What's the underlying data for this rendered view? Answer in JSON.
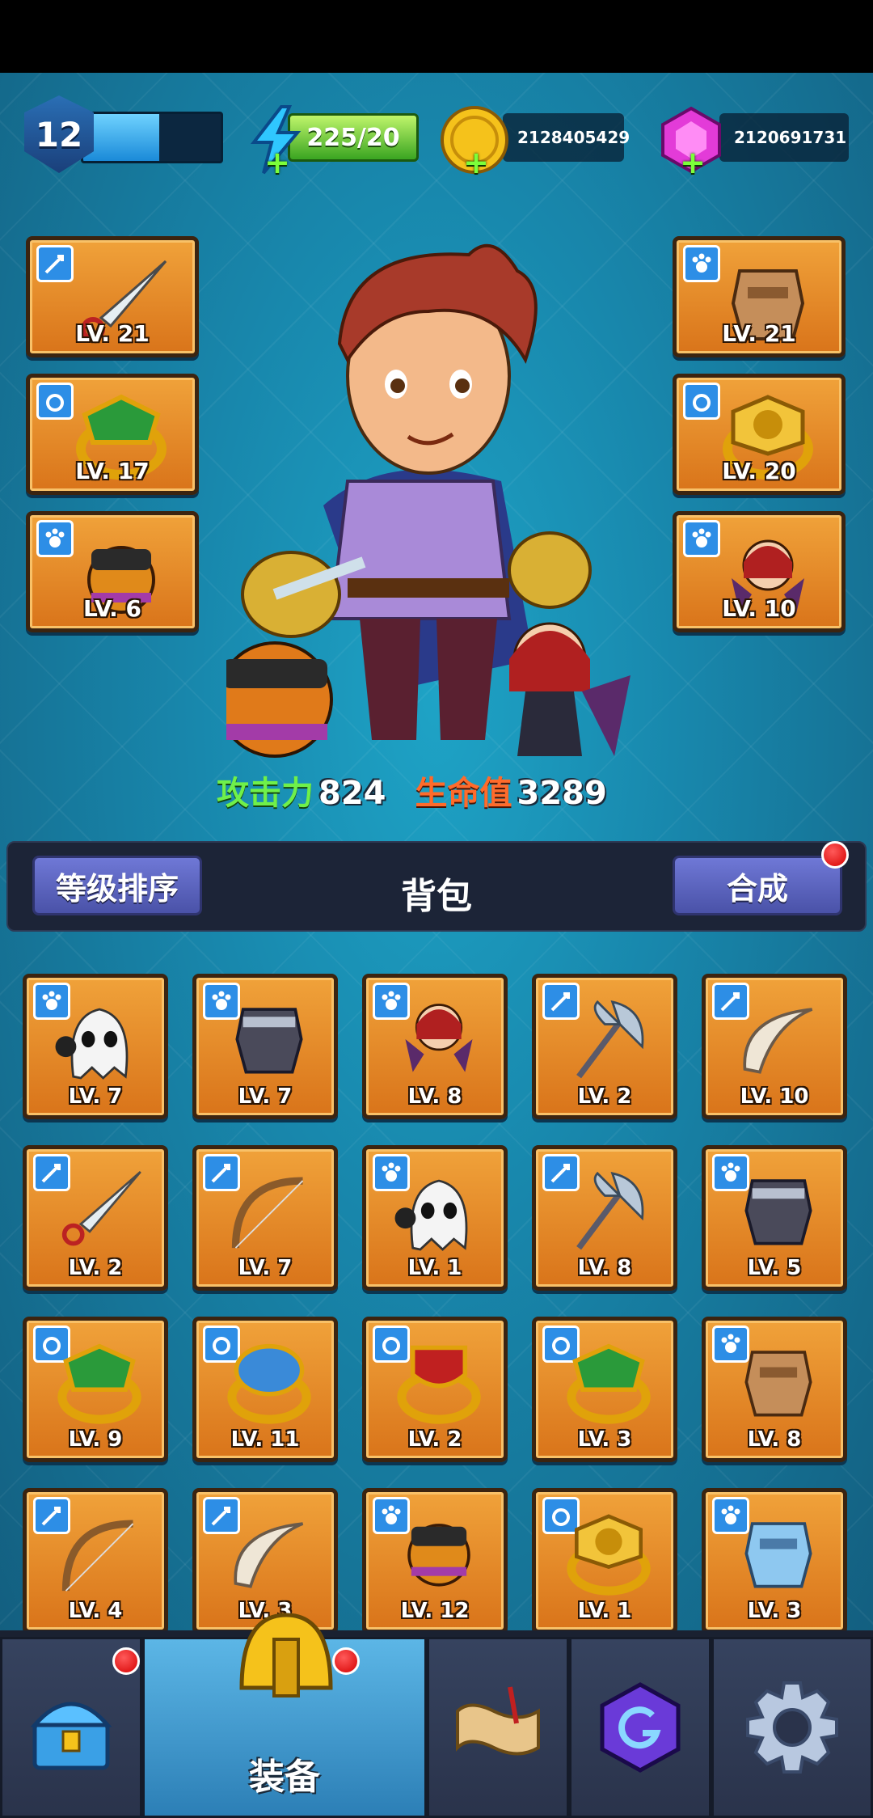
{
  "player": {
    "level": "12",
    "xp_fraction": 0.55
  },
  "resources": {
    "energy": "225/20",
    "coins": "2128405429",
    "gems": "2120691731"
  },
  "equipped": {
    "weapon": {
      "type": "sword-type",
      "item": "dagger",
      "level": "LV. 21"
    },
    "armor": {
      "type": "armor-type",
      "item": "leather-armor",
      "level": "LV. 21"
    },
    "ring_left": {
      "type": "ring-type",
      "item": "green-bow-ring",
      "level": "LV. 17"
    },
    "ring_right": {
      "type": "ring-type",
      "item": "lion-ring",
      "level": "LV. 20"
    },
    "pet_left": {
      "type": "pet-type",
      "item": "viking-pet",
      "level": "LV. 6"
    },
    "pet_right": {
      "type": "pet-type",
      "item": "demon-girl-pet",
      "level": "LV. 10"
    }
  },
  "stats": {
    "attack_label": "攻击力",
    "attack_value": "824",
    "hp_label": "生命值",
    "hp_value": "3289"
  },
  "backpack": {
    "sort_label": "等级排序",
    "title": "背包",
    "merge_label": "合成",
    "items": [
      {
        "type": "pet",
        "item": "ghost-bomb",
        "level": "LV. 7"
      },
      {
        "type": "armor",
        "item": "dark-armor",
        "level": "LV. 7"
      },
      {
        "type": "pet",
        "item": "demon-girl",
        "level": "LV. 8"
      },
      {
        "type": "weapon",
        "item": "axe",
        "level": "LV. 2"
      },
      {
        "type": "weapon",
        "item": "boomerang",
        "level": "LV. 10"
      },
      {
        "type": "weapon",
        "item": "dagger",
        "level": "LV. 2"
      },
      {
        "type": "weapon",
        "item": "bow",
        "level": "LV. 7"
      },
      {
        "type": "pet",
        "item": "ghost-bomb",
        "level": "LV. 1"
      },
      {
        "type": "weapon",
        "item": "axe",
        "level": "LV. 8"
      },
      {
        "type": "armor",
        "item": "dark-armor",
        "level": "LV. 5"
      },
      {
        "type": "ring",
        "item": "green-bow-ring",
        "level": "LV. 9"
      },
      {
        "type": "ring",
        "item": "wing-ring",
        "level": "LV. 11"
      },
      {
        "type": "ring",
        "item": "sword-ring",
        "level": "LV. 2"
      },
      {
        "type": "ring",
        "item": "green-bow-ring",
        "level": "LV. 3"
      },
      {
        "type": "armor",
        "item": "leather-armor",
        "level": "LV. 8"
      },
      {
        "type": "weapon",
        "item": "bow",
        "level": "LV. 4"
      },
      {
        "type": "weapon",
        "item": "boomerang",
        "level": "LV. 3"
      },
      {
        "type": "pet",
        "item": "viking-pet",
        "level": "LV. 12"
      },
      {
        "type": "ring",
        "item": "lion-ring",
        "level": "LV. 1"
      },
      {
        "type": "armor",
        "item": "blue-armor",
        "level": "LV. 3"
      }
    ]
  },
  "nav": {
    "tabs": [
      {
        "icon": "treasure-chest-icon",
        "label": "",
        "badge": true
      },
      {
        "icon": "helmet-icon",
        "label": "装备",
        "badge": true,
        "active": true
      },
      {
        "icon": "scroll-map-icon",
        "label": ""
      },
      {
        "icon": "purple-gem-icon",
        "label": ""
      },
      {
        "icon": "gear-icon",
        "label": ""
      }
    ]
  },
  "colors": {
    "slot_orange": "#e8892a",
    "type_badge_blue": "#2d8ee6",
    "attack_green": "#6ff04a",
    "hp_orange": "#ff6b2b",
    "button_purple": "#5a62be"
  }
}
